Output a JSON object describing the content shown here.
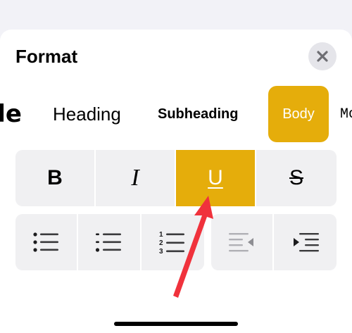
{
  "panel": {
    "title": "Format",
    "close_icon": "xmark-icon"
  },
  "text_styles": [
    {
      "label": "Title",
      "visible_label": "tle",
      "selected": false
    },
    {
      "label": "Heading",
      "selected": false
    },
    {
      "label": "Subheading",
      "selected": false
    },
    {
      "label": "Body",
      "selected": true
    },
    {
      "label": "Mo",
      "selected": false
    }
  ],
  "formatting": [
    {
      "name": "bold",
      "glyph": "B",
      "active": false
    },
    {
      "name": "italic",
      "glyph": "I",
      "active": false
    },
    {
      "name": "underline",
      "glyph": "U",
      "active": true
    },
    {
      "name": "strikethrough",
      "glyph": "S",
      "active": false
    }
  ],
  "list_buttons": [
    {
      "name": "bulleted-list",
      "icon": "list-bullet-icon"
    },
    {
      "name": "dashed-list",
      "icon": "list-dash-icon"
    },
    {
      "name": "numbered-list",
      "icon": "list-number-icon",
      "numbers": [
        "1",
        "2",
        "3"
      ]
    }
  ],
  "indent_buttons": [
    {
      "name": "decrease-indent",
      "icon": "decrease-indent-icon",
      "enabled": false
    },
    {
      "name": "increase-indent",
      "icon": "increase-indent-icon",
      "enabled": true
    }
  ],
  "colors": {
    "accent": "#e5ad0b",
    "annotation_arrow": "#f0323c"
  }
}
